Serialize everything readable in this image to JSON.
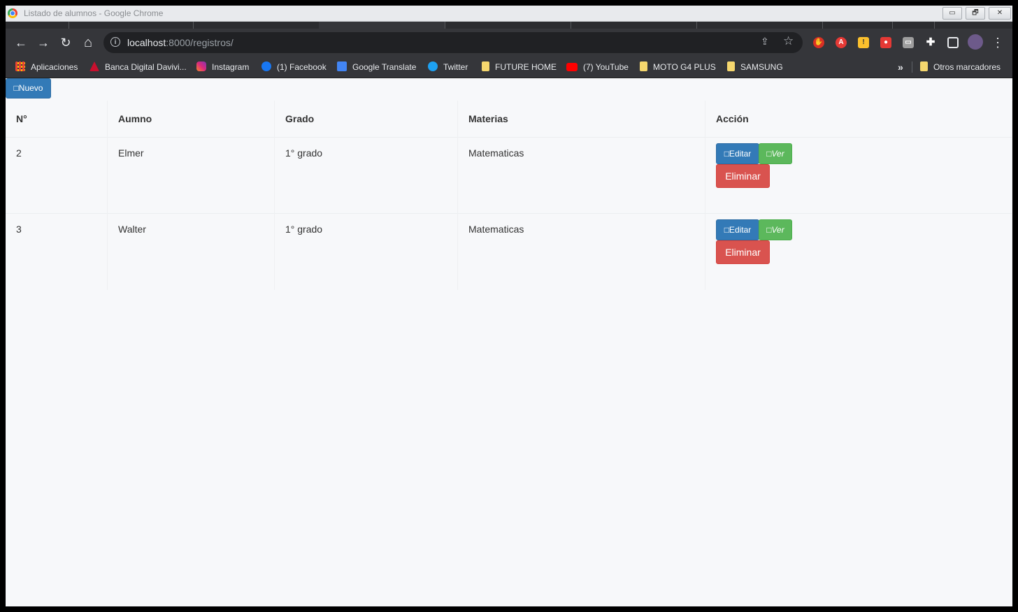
{
  "window": {
    "title": "Listado de alumnos - Google Chrome",
    "minimize": "▭",
    "restore": "🗗",
    "close": "✕"
  },
  "toolbar": {
    "back_icon": "←",
    "forward_icon": "→",
    "reload_icon": "↻",
    "home_icon": "⌂",
    "url_host": "localhost",
    "url_path": ":8000/registros/",
    "info_icon": "i",
    "share_icon": "⇪",
    "star_icon": "☆",
    "menu_icon": "⋮"
  },
  "bookmarks": {
    "items": [
      {
        "label": "Aplicaciones",
        "icon": "apps-grid-icon"
      },
      {
        "label": "Banca Digital Davivi...",
        "icon": "davivienda-icon"
      },
      {
        "label": "Instagram",
        "icon": "instagram-icon"
      },
      {
        "label": "(1) Facebook",
        "icon": "facebook-icon"
      },
      {
        "label": "Google Translate",
        "icon": "translate-icon"
      },
      {
        "label": "Twitter",
        "icon": "twitter-icon"
      },
      {
        "label": "FUTURE HOME",
        "icon": "folder-icon"
      },
      {
        "label": "(7) YouTube",
        "icon": "youtube-icon"
      },
      {
        "label": "MOTO G4 PLUS",
        "icon": "folder-icon"
      },
      {
        "label": "SAMSUNG",
        "icon": "folder-icon"
      }
    ],
    "more": "»",
    "other": "Otros marcadores"
  },
  "page": {
    "new_button": "□Nuevo",
    "headers": [
      "N°",
      "Aumno",
      "Grado",
      "Materias",
      "Acción"
    ],
    "rows": [
      {
        "n": "2",
        "alumno": "Elmer",
        "grado": "1° grado",
        "materias": "Matematicas"
      },
      {
        "n": "3",
        "alumno": "Walter",
        "grado": "1° grado",
        "materias": "Matematicas"
      }
    ],
    "edit_label": "□Editar",
    "view_label": "□Ver",
    "delete_label": "Eliminar"
  },
  "colors": {
    "primary": "#337ab7",
    "success": "#5cb85c",
    "danger": "#d9534f",
    "chrome_dark": "#35363a"
  }
}
